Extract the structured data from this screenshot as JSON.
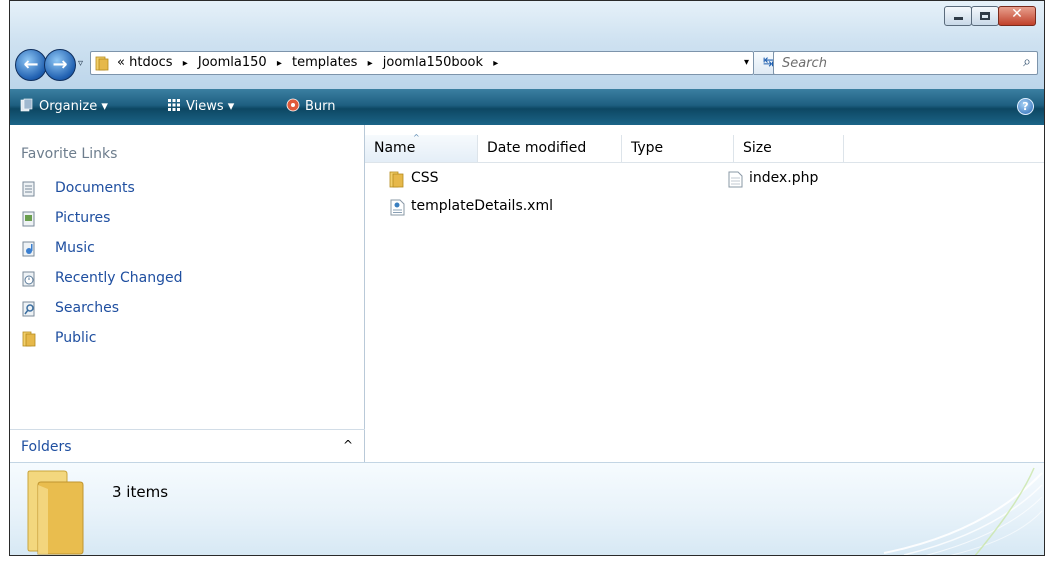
{
  "window": {
    "controls": [
      "minimize",
      "maximize",
      "close"
    ],
    "close_glyph": "✕"
  },
  "navigation": {
    "back_icon": "back-arrow-icon",
    "forward_icon": "forward-arrow-icon",
    "back_glyph": "←",
    "forward_glyph": "→",
    "recent_glyph": "▿"
  },
  "address": {
    "lead": "«",
    "crumbs": [
      "htdocs",
      "Joomla150",
      "templates",
      "joomla150book"
    ],
    "separator": "▸",
    "dropdown_glyph": "▾",
    "refresh_glyph": "↹"
  },
  "search": {
    "placeholder": "Search",
    "icon_glyph": "⌕"
  },
  "toolbar": {
    "organize_label": "Organize ▾",
    "views_label": "Views ▾",
    "burn_label": "Burn",
    "help_label": "?"
  },
  "nav_pane": {
    "title": "Favorite Links",
    "items": [
      {
        "label": "Documents",
        "icon": "documents-icon"
      },
      {
        "label": "Pictures",
        "icon": "pictures-icon"
      },
      {
        "label": "Music",
        "icon": "music-icon"
      },
      {
        "label": "Recently Changed",
        "icon": "recently-changed-icon"
      },
      {
        "label": "Searches",
        "icon": "searches-icon"
      },
      {
        "label": "Public",
        "icon": "folder-icon"
      }
    ],
    "folders_label": "Folders",
    "folders_chevron": "^"
  },
  "columns": [
    "Name",
    "Date modified",
    "Type",
    "Size"
  ],
  "sort_arrow": "^",
  "files": [
    {
      "name": "CSS",
      "icon": "folder-icon"
    },
    {
      "name": "index.php",
      "icon": "file-icon"
    },
    {
      "name": "templateDetails.xml",
      "icon": "xml-file-icon"
    }
  ],
  "details": {
    "count": "3 items"
  },
  "colors": {
    "toolbar": "#1e5f80",
    "link": "#1f4fa0",
    "nav_title": "#6d7d8d",
    "folder": "#e8c15a"
  }
}
